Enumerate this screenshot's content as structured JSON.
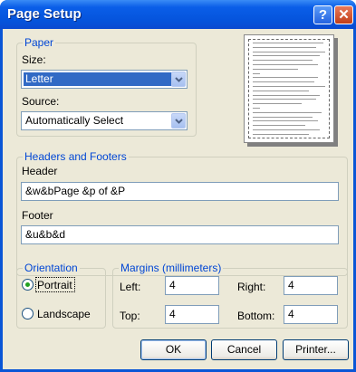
{
  "window": {
    "title": "Page Setup",
    "help_glyph": "?",
    "close_glyph": "✕"
  },
  "paper": {
    "legend": "Paper",
    "size_label": "Size:",
    "size_value": "Letter",
    "source_label": "Source:",
    "source_value": "Automatically Select"
  },
  "headers_footers": {
    "legend": "Headers and Footers",
    "header_label": "Header",
    "header_value": "&w&bPage &p of &P",
    "footer_label": "Footer",
    "footer_value": "&u&b&d"
  },
  "orientation": {
    "legend": "Orientation",
    "options": [
      "Portrait",
      "Landscape"
    ],
    "selected": "Portrait"
  },
  "margins": {
    "legend": "Margins (millimeters)",
    "left_label": "Left:",
    "left_value": "4",
    "right_label": "Right:",
    "right_value": "4",
    "top_label": "Top:",
    "top_value": "4",
    "bottom_label": "Bottom:",
    "bottom_value": "4"
  },
  "buttons": {
    "ok": "OK",
    "cancel": "Cancel",
    "printer": "Printer..."
  },
  "icons": {
    "dropdown": "chevron-down-icon",
    "help": "help-icon",
    "close": "close-icon"
  }
}
